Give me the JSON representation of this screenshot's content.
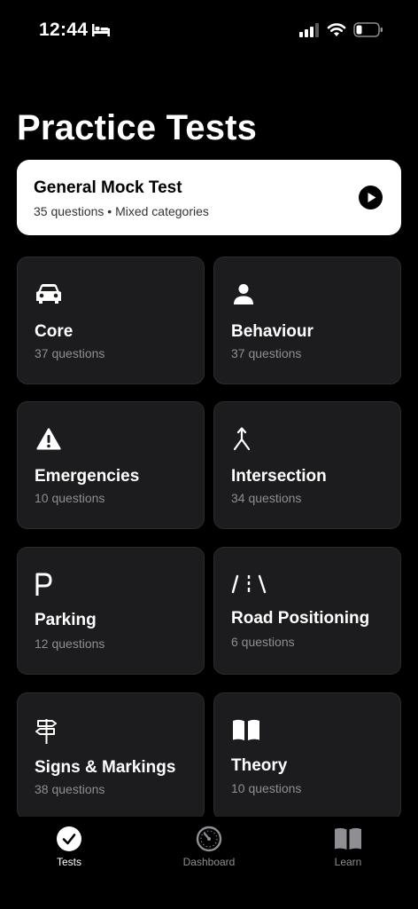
{
  "status_bar": {
    "time": "12:44"
  },
  "page_title": "Practice Tests",
  "mock_test": {
    "title": "General Mock Test",
    "subtitle": "35 questions • Mixed categories"
  },
  "categories": [
    {
      "label": "Core",
      "count": "37 questions",
      "icon": "car-icon"
    },
    {
      "label": "Behaviour",
      "count": "37 questions",
      "icon": "person-icon"
    },
    {
      "label": "Emergencies",
      "count": "10 questions",
      "icon": "warning-icon"
    },
    {
      "label": "Intersection",
      "count": "34 questions",
      "icon": "merge-arrow-icon"
    },
    {
      "label": "Parking",
      "count": "12 questions",
      "icon": "parking-icon"
    },
    {
      "label": "Road Positioning",
      "count": "6 questions",
      "icon": "road-lanes-icon"
    },
    {
      "label": "Signs & Markings",
      "count": "38 questions",
      "icon": "signpost-icon"
    },
    {
      "label": "Theory",
      "count": "10 questions",
      "icon": "book-icon"
    }
  ],
  "tab_bar": {
    "tests": "Tests",
    "dashboard": "Dashboard",
    "learn": "Learn"
  },
  "colors": {
    "background": "#000000",
    "card": "#1c1c1e",
    "secondary_text": "#8e8e93"
  }
}
